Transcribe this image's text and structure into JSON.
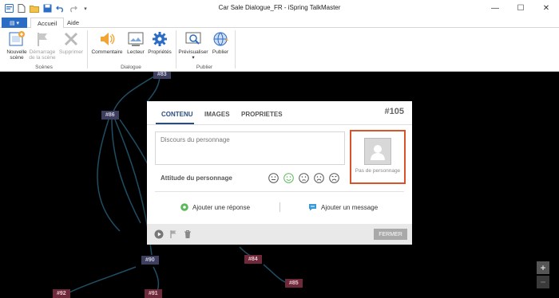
{
  "window": {
    "title": "Car Sale Dialogue_FR - iSpring TalkMaster"
  },
  "ribbon": {
    "tabs": [
      "Accueil",
      "Aide"
    ],
    "buttons": {
      "nouvelle_scene": "Nouvelle scène",
      "demarrage_scene": "Démarrage de la scène",
      "supprimer": "Supprimer",
      "commentaire": "Commentaire",
      "lecteur": "Lecteur",
      "proprietes": "Propriétés",
      "previsualiser": "Prévisualiser",
      "publier": "Publier"
    },
    "groups": {
      "scenes": "Scènes",
      "dialogue": "Dialogue",
      "publier": "Publier"
    }
  },
  "canvas": {
    "nodes": [
      "#83",
      "#86",
      "#90",
      "#84",
      "#85",
      "#92",
      "#91"
    ],
    "zoom_in": "+",
    "zoom_out": "−"
  },
  "dialog": {
    "tabs": [
      "CONTENU",
      "IMAGES",
      "PROPRIETES"
    ],
    "number": "#105",
    "speech_placeholder": "Discours du personnage",
    "character_label": "Pas de personnage",
    "attitude_label": "Attitude du personnage",
    "add_response": "Ajouter une réponse",
    "add_message": "Ajouter un message",
    "close_button": "FERMER"
  },
  "colors": {
    "accent": "#2b6cc4",
    "highlight": "#d9532a",
    "canvas_bg": "#000000"
  }
}
